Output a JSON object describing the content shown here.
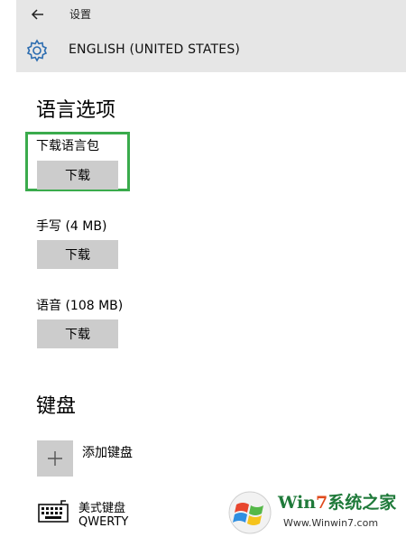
{
  "header": {
    "title": "设置",
    "language_name": "ENGLISH (UNITED STATES)"
  },
  "language_options": {
    "heading": "语言选项",
    "language_pack": {
      "label": "下载语言包",
      "button": "下载"
    },
    "handwriting": {
      "label": "手写 (4 MB)",
      "button": "下载"
    },
    "speech": {
      "label": "语音 (108 MB)",
      "button": "下载"
    }
  },
  "keyboard": {
    "heading": "键盘",
    "add_label": "添加键盘",
    "installed": {
      "name": "美式键盘",
      "layout": "QWERTY"
    }
  },
  "watermark": {
    "brand_prefix": "Win",
    "brand_seven": "7",
    "brand_suffix": "系统之家",
    "url": "Www.Winwin7.com"
  },
  "colors": {
    "header_bg": "#e6e6e6",
    "button_bg": "#cccccc",
    "highlight": "#3aab4c",
    "accent": "#2b6cb0"
  },
  "icons": [
    "back-arrow-icon",
    "gear-icon",
    "plus-icon",
    "keyboard-icon",
    "windows-logo-icon"
  ]
}
